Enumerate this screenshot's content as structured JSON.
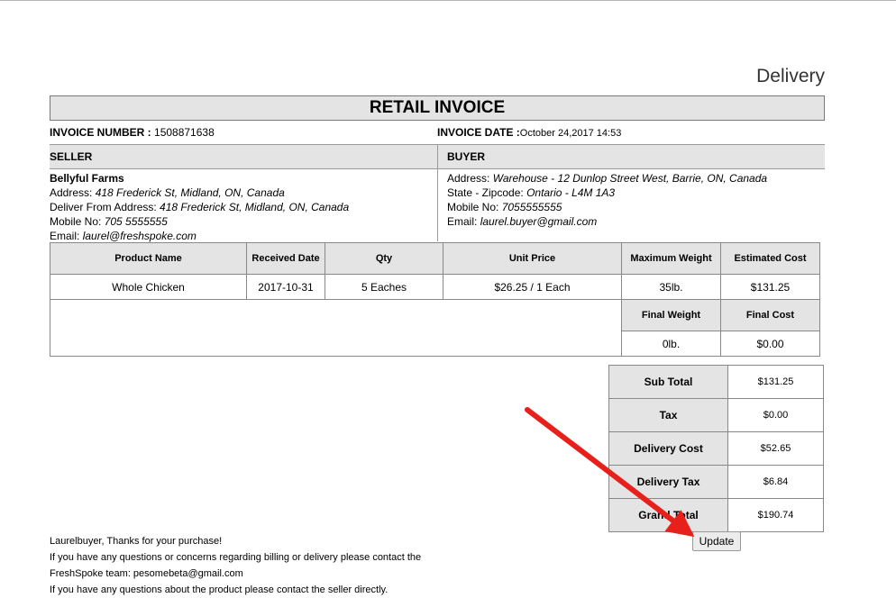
{
  "page": {
    "heading": "Delivery"
  },
  "invoice": {
    "title": "RETAIL INVOICE",
    "number_label": "INVOICE NUMBER :",
    "number": "1508871638",
    "date_label": "INVOICE DATE :",
    "date": "October 24,2017 14:53"
  },
  "seller": {
    "header": "SELLER",
    "name": "Bellyful Farms",
    "address_label": "Address:",
    "address": "418 Frederick St, Midland, ON, Canada",
    "deliver_from_label": "Deliver From Address:",
    "deliver_from": "418 Frederick St, Midland, ON, Canada",
    "mobile_label": "Mobile No:",
    "mobile": "705 5555555",
    "email_label": "Email:",
    "email": "laurel@freshspoke.com"
  },
  "buyer": {
    "header": "BUYER",
    "address_label": "Address:",
    "address": "Warehouse - 12 Dunlop Street West, Barrie, ON, Canada",
    "state_label": "State - Zipcode:",
    "state": "Ontario - L4M 1A3",
    "mobile_label": "Mobile No:",
    "mobile": "7055555555",
    "email_label": "Email:",
    "email": "laurel.buyer@gmail.com"
  },
  "items": {
    "headers": [
      "Product Name",
      "Received Date",
      "Qty",
      "Unit Price",
      "Maximum Weight",
      "Estimated Cost"
    ],
    "row": [
      "Whole Chicken",
      "2017-10-31",
      "5 Eaches",
      "$26.25 / 1 Each",
      "35lb.",
      "$131.25"
    ],
    "final_weight_label": "Final Weight",
    "final_cost_label": "Final Cost",
    "final_weight": "0lb.",
    "final_cost": "$0.00"
  },
  "totals": [
    {
      "label": "Sub Total",
      "value": "$131.25"
    },
    {
      "label": "Tax",
      "value": "$0.00"
    },
    {
      "label": "Delivery Cost",
      "value": "$52.65"
    },
    {
      "label": "Delivery Tax",
      "value": "$6.84"
    },
    {
      "label": "Grand Total",
      "value": "$190.74"
    }
  ],
  "footer": {
    "line1": "Laurelbuyer, Thanks for your purchase!",
    "line2": "If you have any questions or concerns regarding billing or delivery please contact the",
    "line3": "FreshSpoke team: pesomebeta@gmail.com",
    "line4": "If you have any questions about the product please contact the seller directly."
  },
  "update_label": "Update",
  "colors": {
    "header_bg": "#e4e4e4",
    "arrow": "#e8201c"
  }
}
